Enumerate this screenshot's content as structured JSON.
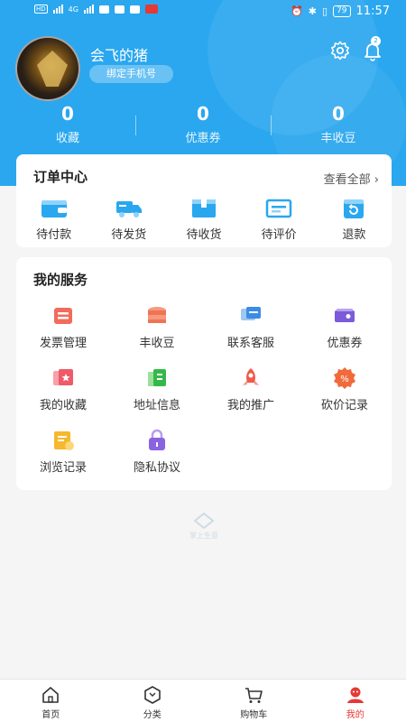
{
  "status_bar": {
    "signal_1": "HD",
    "signal_2": "4G",
    "battery": "79",
    "time": "11:57"
  },
  "profile": {
    "username": "会飞的猪",
    "bind_phone": "绑定手机号",
    "notification_count": "2"
  },
  "stats": [
    {
      "value": "0",
      "label": "收藏"
    },
    {
      "value": "0",
      "label": "优惠券"
    },
    {
      "value": "0",
      "label": "丰收豆"
    }
  ],
  "orders": {
    "title": "订单中心",
    "view_all": "查看全部",
    "items": [
      {
        "label": "待付款",
        "icon": "wallet-icon"
      },
      {
        "label": "待发货",
        "icon": "truck-icon"
      },
      {
        "label": "待收货",
        "icon": "box-icon"
      },
      {
        "label": "待评价",
        "icon": "review-icon"
      },
      {
        "label": "退款",
        "icon": "refund-icon"
      }
    ]
  },
  "services": {
    "title": "我的服务",
    "items": [
      {
        "label": "发票管理",
        "icon": "invoice-icon"
      },
      {
        "label": "丰收豆",
        "icon": "coin-stack-icon"
      },
      {
        "label": "联系客服",
        "icon": "chat-icon"
      },
      {
        "label": "优惠券",
        "icon": "coupon-icon"
      },
      {
        "label": "我的收藏",
        "icon": "favorite-icon"
      },
      {
        "label": "地址信息",
        "icon": "address-icon"
      },
      {
        "label": "我的推广",
        "icon": "rocket-icon"
      },
      {
        "label": "砍价记录",
        "icon": "discount-icon"
      },
      {
        "label": "浏览记录",
        "icon": "history-icon"
      },
      {
        "label": "隐私协议",
        "icon": "lock-icon"
      }
    ]
  },
  "watermark": "掌上生意",
  "tabbar": [
    {
      "label": "首页",
      "icon": "home-icon"
    },
    {
      "label": "分类",
      "icon": "category-icon"
    },
    {
      "label": "购物车",
      "icon": "cart-icon"
    },
    {
      "label": "我的",
      "icon": "profile-icon",
      "active": true
    }
  ],
  "colors": {
    "primary": "#2aa7ef",
    "active_tab": "#e53935",
    "order_icon": "#2aa7ef"
  }
}
